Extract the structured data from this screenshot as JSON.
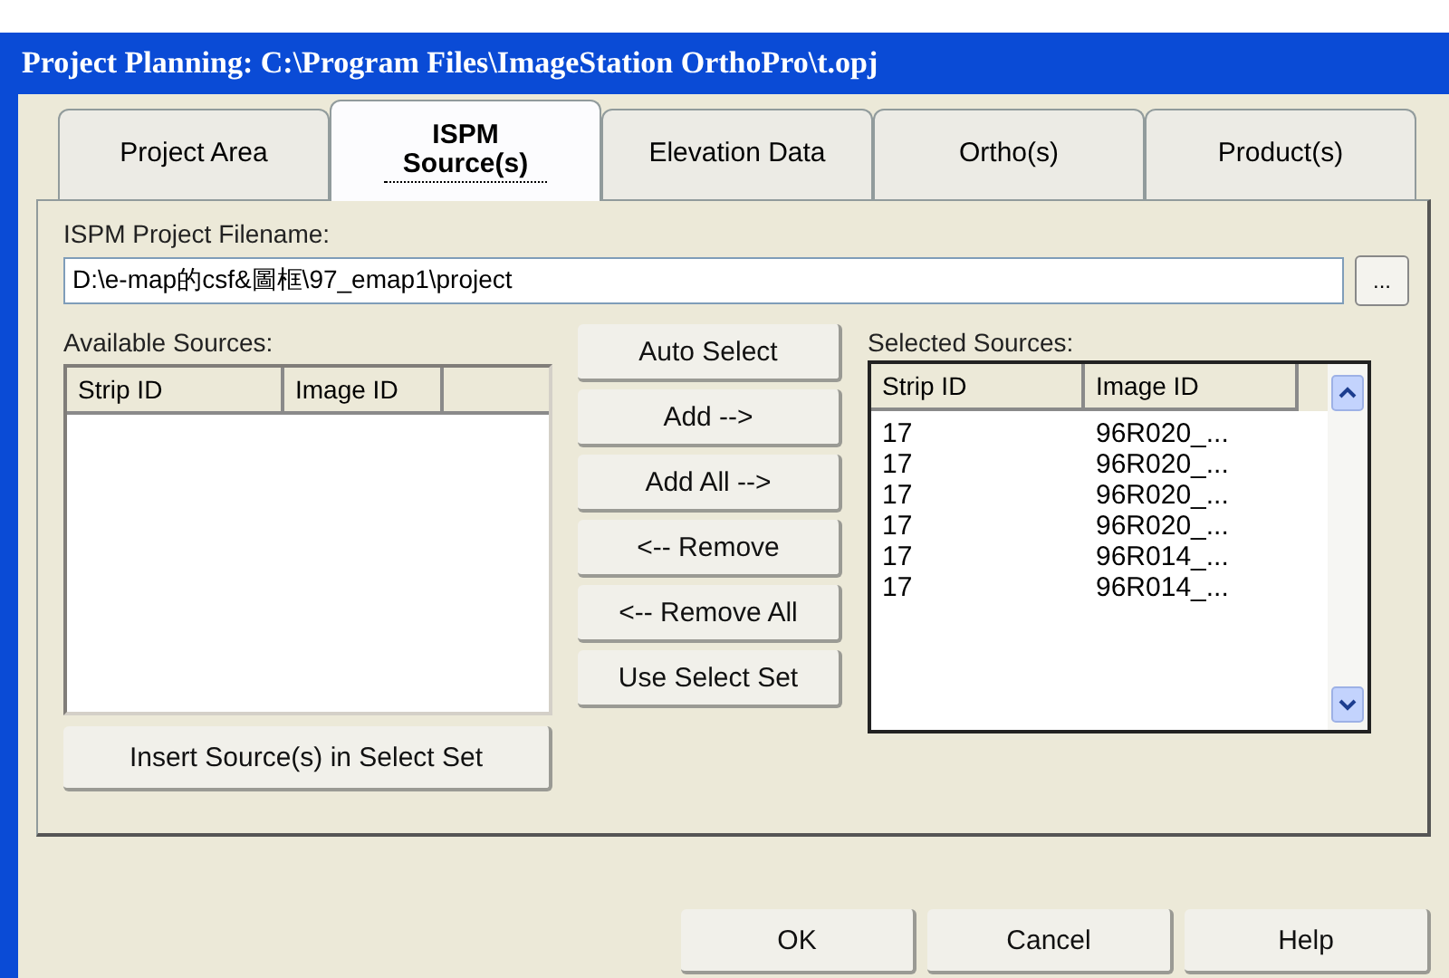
{
  "window": {
    "title": "Project Planning: C:\\Program Files\\ImageStation OrthoPro\\t.opj"
  },
  "tabs": [
    {
      "label": "Project Area",
      "selected": false
    },
    {
      "label": "ISPM Source(s)",
      "selected": true
    },
    {
      "label": "Elevation Data",
      "selected": false
    },
    {
      "label": "Ortho(s)",
      "selected": false
    },
    {
      "label": "Product(s)",
      "selected": false
    }
  ],
  "filename": {
    "label": "ISPM Project Filename:",
    "value": "D:\\e-map的csf&圖框\\97_emap1\\project",
    "browse": "..."
  },
  "available": {
    "label": "Available Sources:",
    "columns": [
      "Strip ID",
      "Image ID"
    ],
    "button": "Insert Source(s) in Select Set"
  },
  "actions": [
    "Auto Select",
    "Add -->",
    "Add All -->",
    "<--  Remove",
    "<-- Remove All",
    "Use Select Set"
  ],
  "selected": {
    "label": "Selected Sources:",
    "columns": [
      "Strip ID",
      "Image ID"
    ],
    "rows": [
      {
        "strip_id": "17",
        "image_id": "96R020_..."
      },
      {
        "strip_id": "17",
        "image_id": "96R020_..."
      },
      {
        "strip_id": "17",
        "image_id": "96R020_..."
      },
      {
        "strip_id": "17",
        "image_id": "96R020_..."
      },
      {
        "strip_id": "17",
        "image_id": "96R014_..."
      },
      {
        "strip_id": "17",
        "image_id": "96R014_..."
      }
    ]
  },
  "buttons": [
    "OK",
    "Cancel",
    "Help"
  ]
}
